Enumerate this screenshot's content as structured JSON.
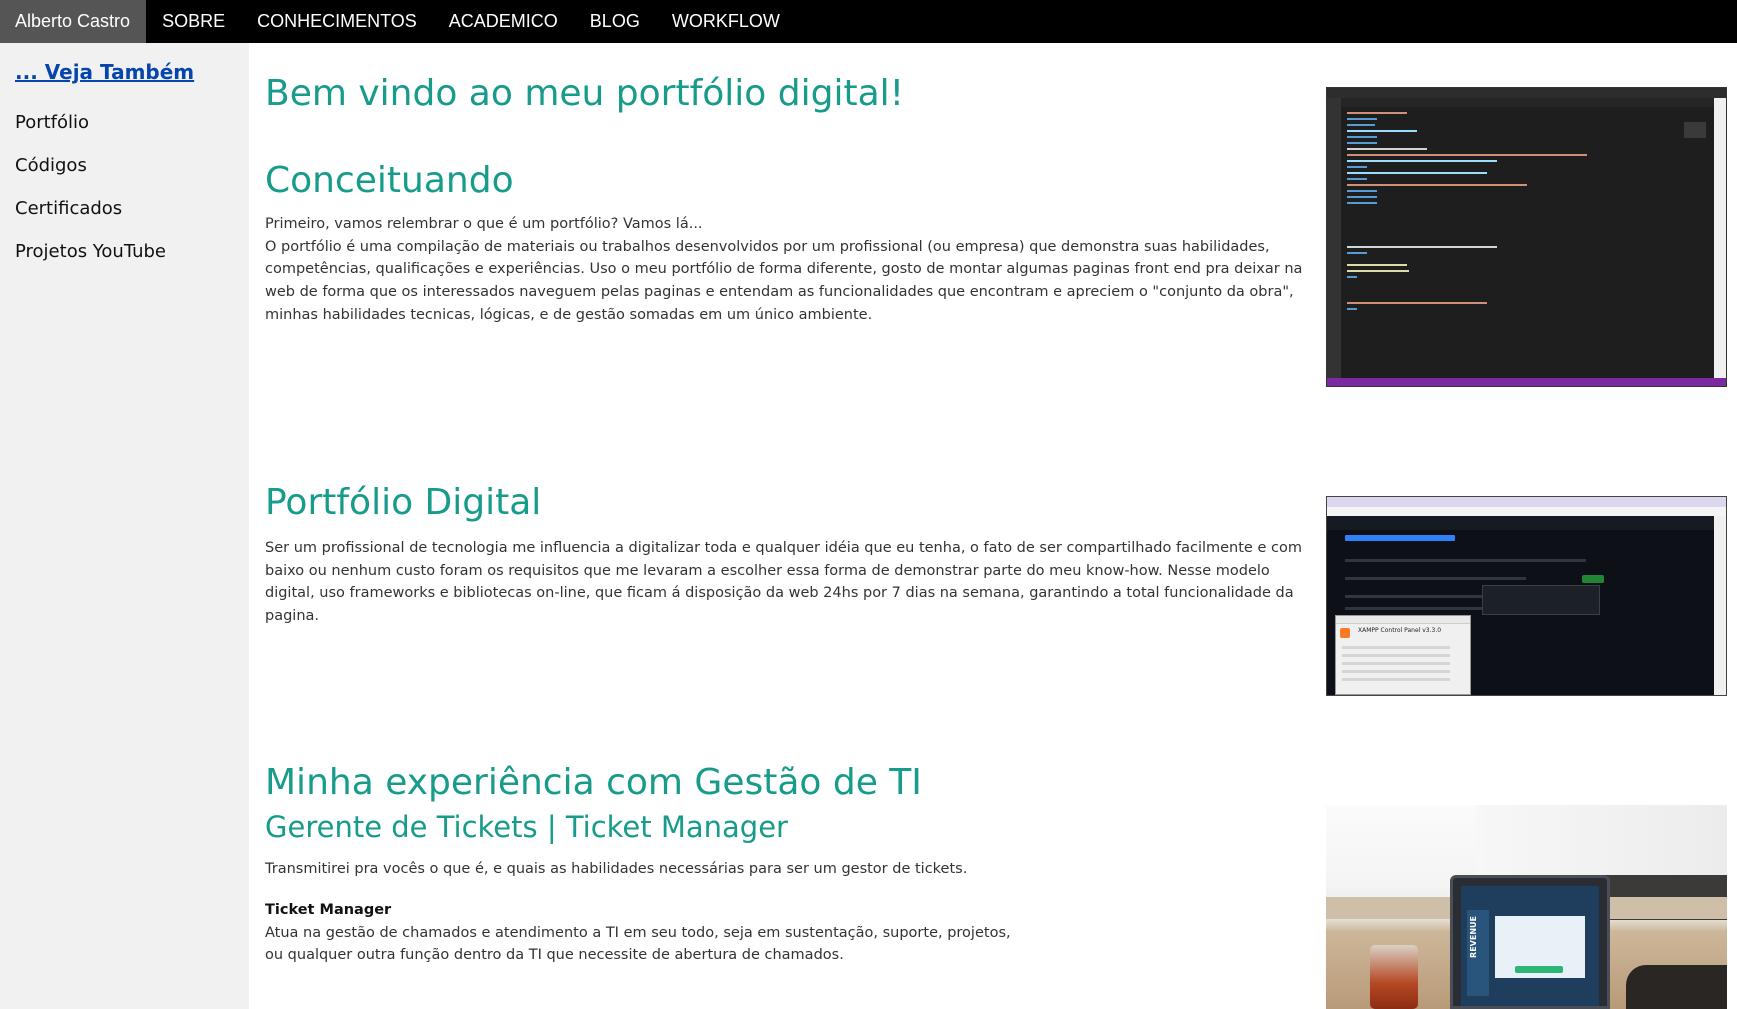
{
  "nav": {
    "brand": "Alberto Castro",
    "items": [
      "SOBRE",
      "CONHECIMENTOS",
      "ACADEMICO",
      "BLOG",
      "WORKFLOW"
    ]
  },
  "sidebar": {
    "title": "... Veja Também",
    "items": [
      "Portfólio",
      "Códigos",
      "Certificados",
      "Projetos YouTube"
    ]
  },
  "main": {
    "welcome": "Bem vindo ao meu portfólio digital!",
    "section1": {
      "title": "Conceituando",
      "line1": "Primeiro, vamos relembrar o que é um portfólio? Vamos lá...",
      "line2": "O portfólio é uma compilação de materiais ou trabalhos desenvolvidos por um profissional (ou empresa) que demonstra suas habilidades, competências, qualificações e experiências. Uso o meu portfólio de forma diferente, gosto de montar algumas paginas front end pra deixar na web de forma que os interessados naveguem pelas paginas e entendam as funcionalidades que encontram e apreciem o \"conjunto da obra\", minhas habilidades tecnicas, lógicas, e de gestão somadas em um único ambiente."
    },
    "section2": {
      "title": "Portfólio Digital",
      "text": "Ser um profissional de tecnologia me influencia a digitalizar toda e qualquer idéia que eu tenha, o fato de ser compartilhado facilmente e com baixo ou nenhum custo foram os requisitos que me levaram a escolher essa forma de demonstrar parte do meu know-how. Nesse modelo digital, uso frameworks e bibliotecas on-line, que ficam á disposição da web 24hs por 7 dias na semana, garantindo a total funcionalidade da pagina."
    },
    "section3": {
      "title": "Minha experiência com Gestão de TI",
      "subtitle": "Gerente de Tickets | Ticket Manager",
      "intro": "Transmitirei pra vocês o que é, e quais as habilidades necessárias para ser um gestor de tickets.",
      "label": "Ticket Manager",
      "line1": "Atua na gestão de chamados e atendimento a TI em seu todo, seja em sustentação, suporte, projetos,",
      "line2": "ou qualquer outra função dentro da TI que necessite de abertura de chamados."
    }
  },
  "images": {
    "vscode": "code-editor-screenshot",
    "github": "github-repo-screenshot",
    "photo": "laptop-photo",
    "xampp_title": "XAMPP Control Panel v3.3.0",
    "laptop_screen_word": "REVENUE"
  },
  "colors": {
    "heading": "#179b8a",
    "nav_bg": "#000000",
    "brand_bg": "#555555",
    "sidebar_bg": "#f1f1f1",
    "link": "#0645ad"
  }
}
